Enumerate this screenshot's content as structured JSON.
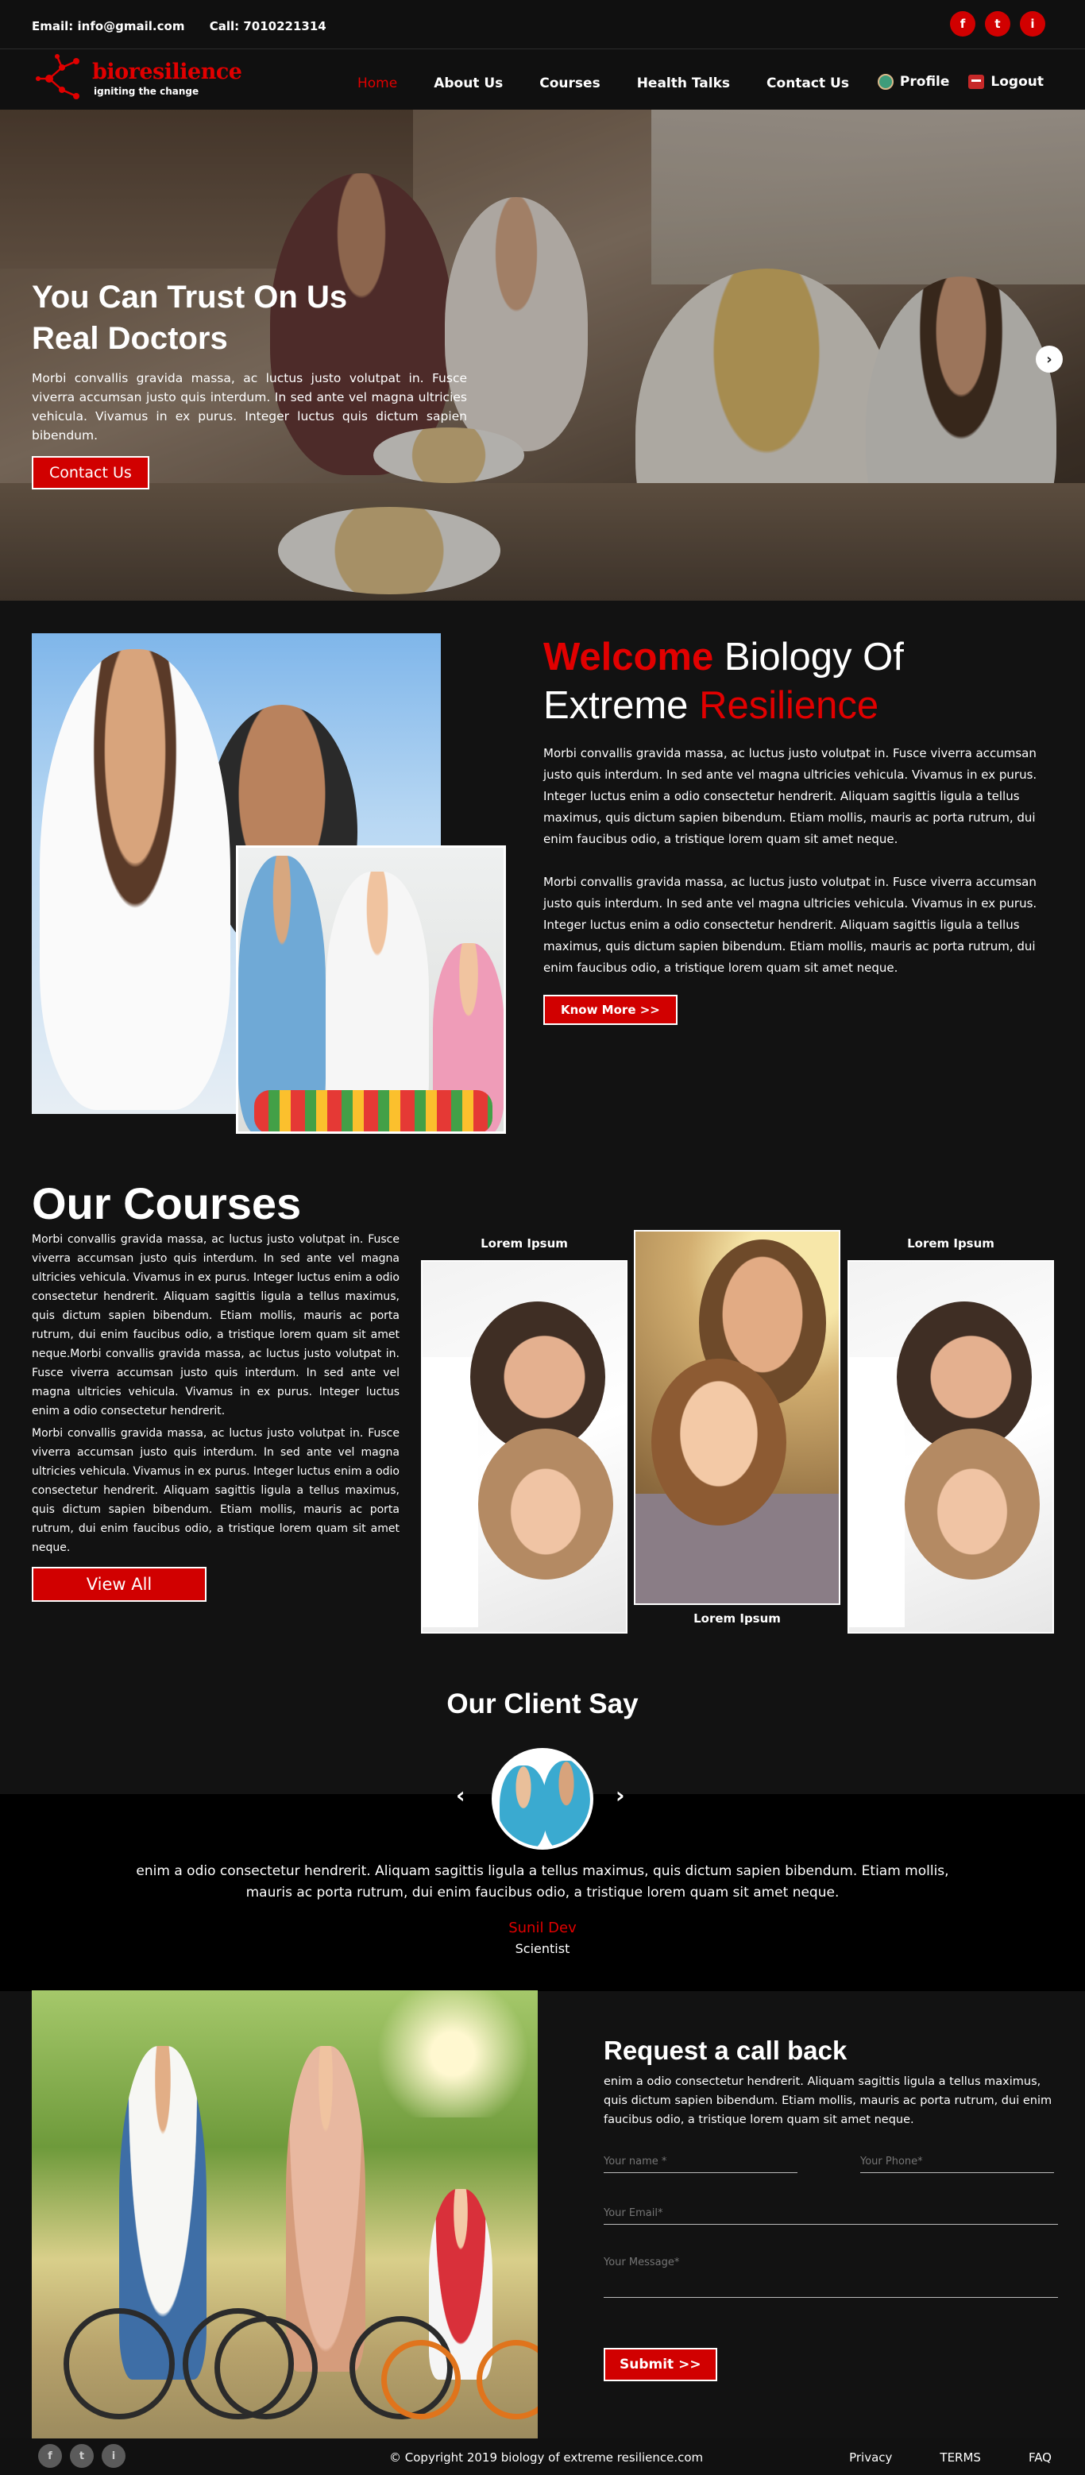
{
  "topbar": {
    "email": "Email: info@gmail.com",
    "phone": "Call: 7010221314",
    "social": [
      "f",
      "t",
      "i"
    ]
  },
  "brand": {
    "name": "bioresilience",
    "tagline": "igniting the change"
  },
  "nav": {
    "links": [
      {
        "label": "Home",
        "active": true
      },
      {
        "label": "About Us"
      },
      {
        "label": "Courses"
      },
      {
        "label": "Health Talks"
      },
      {
        "label": "Contact Us"
      }
    ],
    "profile": "Profile",
    "logout": "Logout"
  },
  "hero": {
    "title_line1": "You Can Trust On Us",
    "title_line2": "Real Doctors",
    "description": "Morbi convallis gravida massa, ac luctus justo volutpat in. Fusce viverra accumsan justo quis interdum. In sed ante vel magna ultricies vehicula. Vivamus in ex purus. Integer luctus quis dictum sapien bibendum.",
    "button": "Contact Us",
    "next": "›"
  },
  "welcome": {
    "w1": "Welcome",
    "w2": " Biology Of",
    "w3": "Extreme ",
    "w4": "Resilience",
    "para1": "Morbi convallis gravida massa, ac luctus justo volutpat in. Fusce viverra accumsan justo quis interdum. In sed ante vel magna ultricies vehicula. Vivamus in ex purus. Integer luctus enim a odio consectetur hendrerit. Aliquam sagittis ligula a tellus maximus, quis dictum sapien bibendum. Etiam mollis, mauris ac porta rutrum, dui enim faucibus odio, a tristique lorem quam sit amet neque.",
    "para2": "Morbi convallis gravida massa, ac luctus justo volutpat in. Fusce viverra accumsan justo quis interdum. In sed ante vel magna ultricies vehicula. Vivamus in ex purus. Integer luctus enim a odio consectetur hendrerit. Aliquam sagittis ligula a tellus maximus, quis dictum sapien bibendum. Etiam mollis, mauris ac porta rutrum, dui enim faucibus odio, a tristique lorem quam sit amet neque.",
    "button": "Know More >>"
  },
  "courses": {
    "title": "Our Courses",
    "para1": "Morbi convallis gravida massa, ac luctus justo volutpat in. Fusce viverra accumsan justo quis interdum. In sed ante vel magna ultricies vehicula. Vivamus in ex purus. Integer luctus enim a odio consectetur hendrerit. Aliquam sagittis ligula a tellus maximus, quis dictum sapien bibendum. Etiam mollis, mauris ac porta rutrum, dui enim faucibus odio, a tristique lorem quam sit amet neque.Morbi convallis gravida massa, ac luctus justo volutpat in. Fusce viverra accumsan justo quis interdum. In sed ante vel magna ultricies vehicula. Vivamus in ex purus. Integer luctus enim a odio consectetur hendrerit.",
    "para2": "Morbi convallis gravida massa, ac luctus justo volutpat in. Fusce viverra accumsan justo quis interdum. In sed ante vel magna ultricies vehicula. Vivamus in ex purus. Integer luctus enim a odio consectetur hendrerit. Aliquam sagittis ligula a tellus maximus, quis dictum sapien bibendum. Etiam mollis, mauris ac porta rutrum, dui enim faucibus odio, a tristique lorem quam sit amet neque.",
    "button": "View All",
    "cards": [
      {
        "label": "Lorem Ipsum"
      },
      {
        "label": "Lorem Ipsum"
      },
      {
        "label": "Lorem Ipsum"
      }
    ]
  },
  "testimonial": {
    "title": "Our Client Say",
    "prev": "‹",
    "next": "›",
    "text": "enim a odio consectetur hendrerit. Aliquam sagittis ligula a tellus maximus, quis dictum sapien bibendum. Etiam mollis, mauris ac porta rutrum, dui enim faucibus odio, a tristique lorem quam sit amet neque.",
    "name": "Sunil Dev",
    "role": "Scientist"
  },
  "callback": {
    "title": "Request a call back",
    "description": "enim a odio consectetur hendrerit. Aliquam sagittis ligula a tellus maximus, quis dictum sapien bibendum. Etiam mollis, mauris ac porta rutrum, dui enim faucibus odio, a tristique lorem quam sit amet neque.",
    "name_placeholder": "Your name *",
    "phone_placeholder": "Your Phone*",
    "email_placeholder": "Your Email*",
    "message_placeholder": "Your Message*",
    "submit": "Submit >>"
  },
  "footer": {
    "social": [
      "f",
      "t",
      "i"
    ],
    "copyright": "© Copyright 2019 biology of extreme resilience.com",
    "links": [
      "Privacy",
      "TERMS",
      "FAQ"
    ]
  },
  "colors": {
    "accent": "#d10000",
    "background": "#121212",
    "text": "#ffffff"
  }
}
